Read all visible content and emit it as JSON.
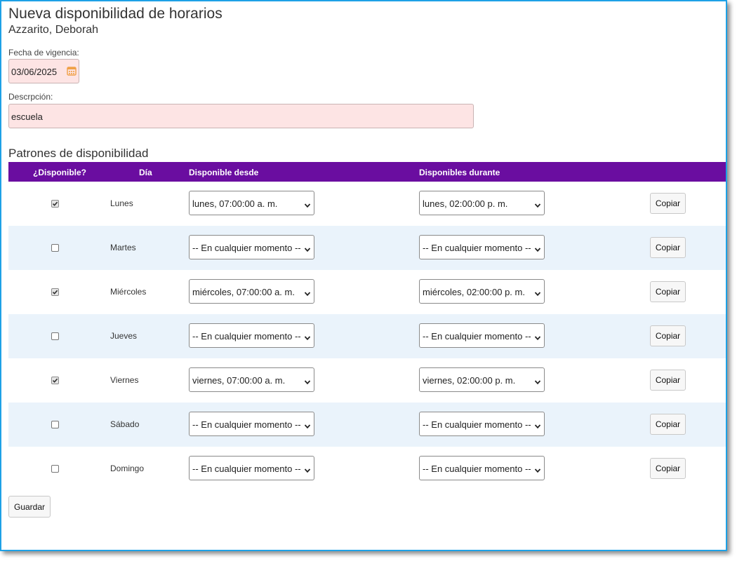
{
  "header": {
    "title": "Nueva disponibilidad de horarios",
    "employee": "Azzarito, Deborah"
  },
  "form": {
    "effective_date_label": "Fecha de vigencia:",
    "effective_date_value": "03/06/2025",
    "description_label": "Descrpción:",
    "description_value": "escuela"
  },
  "section_title": "Patrones de disponibilidad",
  "table": {
    "headers": {
      "available": "¿Disponible?",
      "day": "Día",
      "from": "Disponible desde",
      "during": "Disponibles durante"
    },
    "rows": [
      {
        "day": "Lunes",
        "checked": true,
        "from": "lunes, 07:00:00 a. m.",
        "during": "lunes, 02:00:00 p. m.",
        "copy": "Copiar"
      },
      {
        "day": "Martes",
        "checked": false,
        "from": "-- En cualquier momento --",
        "during": "-- En cualquier momento --",
        "copy": "Copiar"
      },
      {
        "day": "Miércoles",
        "checked": true,
        "from": "miércoles, 07:00:00 a. m.",
        "during": "miércoles, 02:00:00 p. m.",
        "copy": "Copiar"
      },
      {
        "day": "Jueves",
        "checked": false,
        "from": "-- En cualquier momento --",
        "during": "-- En cualquier momento --",
        "copy": "Copiar"
      },
      {
        "day": "Viernes",
        "checked": true,
        "from": "viernes, 07:00:00 a. m.",
        "during": "viernes, 02:00:00 p. m.",
        "copy": "Copiar"
      },
      {
        "day": "Sábado",
        "checked": false,
        "from": "-- En cualquier momento --",
        "during": "-- En cualquier momento --",
        "copy": "Copiar"
      },
      {
        "day": "Domingo",
        "checked": false,
        "from": "-- En cualquier momento --",
        "during": "-- En cualquier momento --",
        "copy": "Copiar"
      }
    ]
  },
  "actions": {
    "save_label": "Guardar"
  },
  "colors": {
    "header_bar": "#6a0da0",
    "alt_row": "#eaf3fb",
    "required_field": "#fde4e4",
    "frame_border": "#1ea1e6",
    "calendar_icon": "#f0a046"
  }
}
